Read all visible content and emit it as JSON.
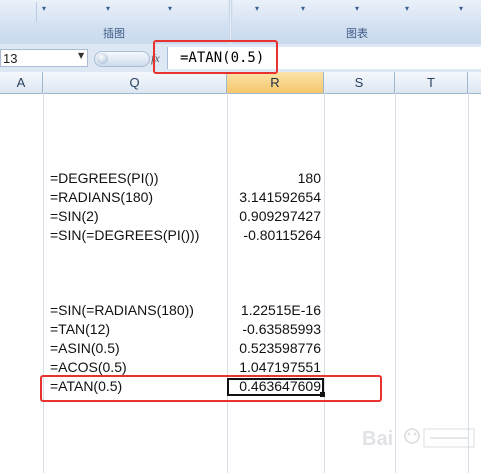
{
  "ribbon": {
    "groups": [
      {
        "label": "插图"
      },
      {
        "label": "图表"
      }
    ]
  },
  "formula_bar": {
    "name_box": "13",
    "fx_icon": "function-icon",
    "formula": "=ATAN(0.5)"
  },
  "columns": [
    "A",
    "Q",
    "R",
    "S",
    "T"
  ],
  "rows": [
    {
      "formula": "=DEGREES(PI())",
      "value": "180"
    },
    {
      "formula": "=RADIANS(180)",
      "value": "3.141592654"
    },
    {
      "formula": "=SIN(2)",
      "value": "0.909297427"
    },
    {
      "formula": "=SIN(=DEGREES(PI()))",
      "value": "-0.80115264"
    },
    {
      "formula": "=SIN(=RADIANS(180))",
      "value": "1.22515E-16"
    },
    {
      "formula": "=TAN(12)",
      "value": "-0.63585993"
    },
    {
      "formula": "=ASIN(0.5)",
      "value": "0.523598776"
    },
    {
      "formula": "=ACOS(0.5)",
      "value": "1.047197551"
    },
    {
      "formula": "=ATAN(0.5)",
      "value": "0.463647609"
    }
  ],
  "colors": {
    "annotation": "#e8322e",
    "selected_column_header": "#f6c66b",
    "ribbon_background": "#c9daee"
  }
}
